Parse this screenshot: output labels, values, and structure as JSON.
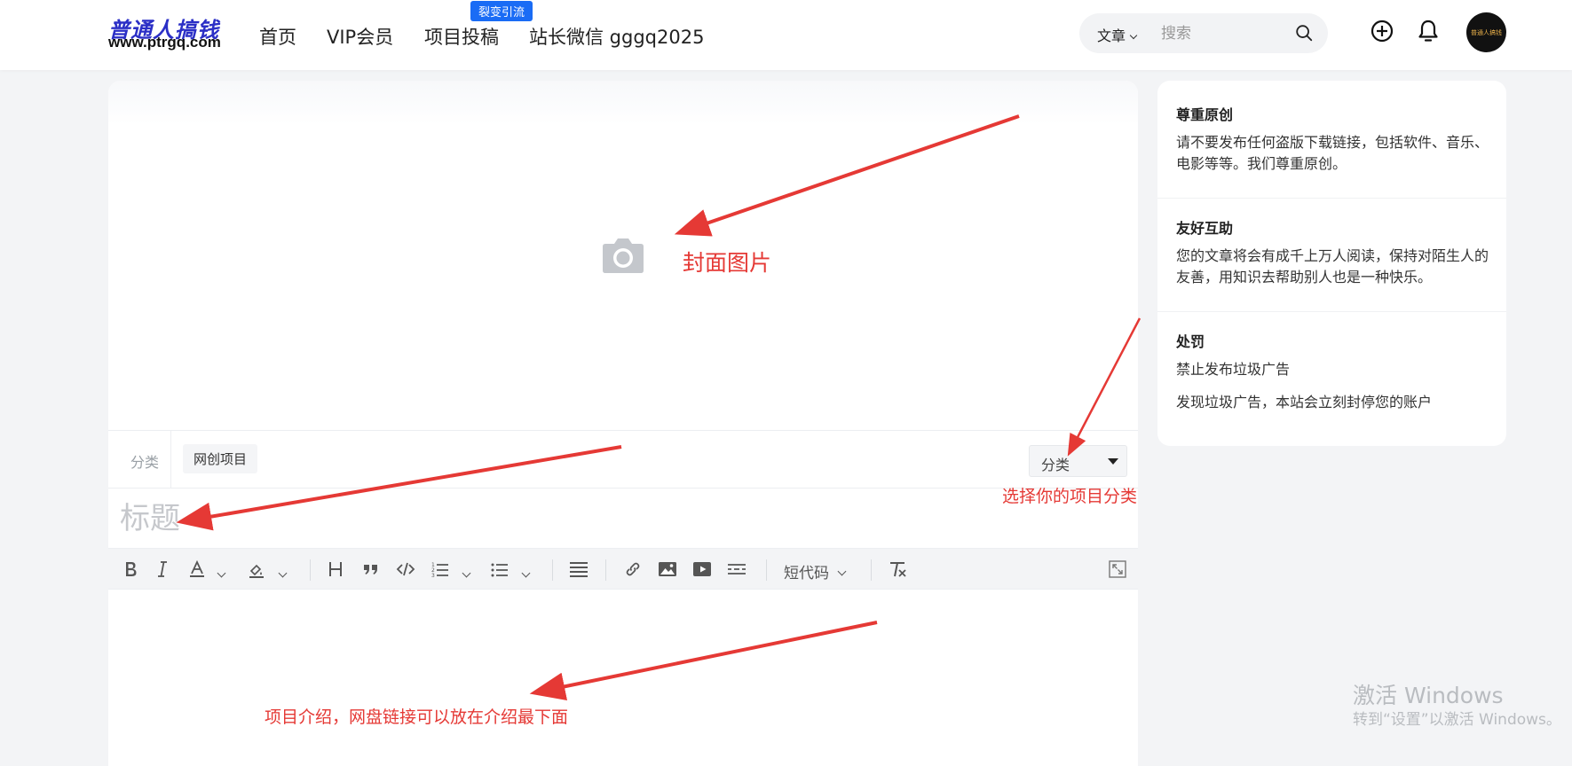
{
  "header": {
    "logo_cn": "普通人搞钱",
    "logo_url": "www.ptrgq.com",
    "nav": [
      {
        "label": "首页"
      },
      {
        "label": "VIP会员"
      },
      {
        "label": "项目投稿"
      },
      {
        "label": "站长微信 gggq2025"
      }
    ],
    "nav_badge": "裂变引流",
    "search": {
      "type": "文章",
      "placeholder": "搜索"
    },
    "avatar_text": "普通人搞钱"
  },
  "editor": {
    "category_label": "分类",
    "category_tag": "网创项目",
    "category_select": "分类",
    "title_placeholder": "标题",
    "toolbar": {
      "shortcode": "短代码"
    }
  },
  "annotations": {
    "cover": "封面图片",
    "category": "选择你的项目分类",
    "intro": "项目介绍，网盘链接可以放在介绍最下面"
  },
  "sidebar": {
    "sections": [
      {
        "title": "尊重原创",
        "lines": [
          "请不要发布任何盗版下载链接，包括软件、音乐、电影等等。我们尊重原创。"
        ]
      },
      {
        "title": "友好互助",
        "lines": [
          "您的文章将会有成千上万人阅读，保持对陌生人的友善，用知识去帮助别人也是一种快乐。"
        ]
      },
      {
        "title": "处罚",
        "lines": [
          "禁止发布垃圾广告",
          "发现垃圾广告，本站会立刻封停您的账户"
        ]
      }
    ]
  },
  "watermark": {
    "line1": "激活 Windows",
    "line2": "转到“设置”以激活 Windows。"
  },
  "colors": {
    "accent": "#1a6cf5",
    "annotation": "#e53935",
    "logo": "#2b2fc6"
  }
}
